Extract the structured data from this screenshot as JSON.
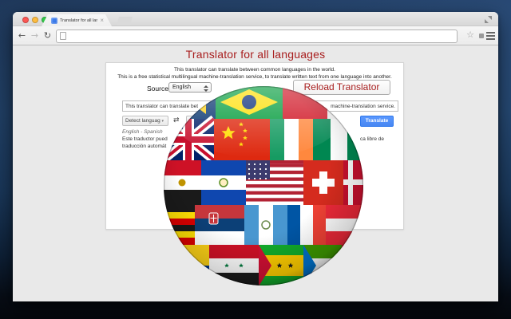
{
  "window": {
    "tab": {
      "title": "Translator for all languages",
      "close_icon": "×"
    },
    "toolbar": {
      "back_icon": "←",
      "forward_icon": "→",
      "reload_icon": "↻",
      "url_value": "",
      "bookmark_icon": "☆"
    }
  },
  "page": {
    "title": "Translator for all languages",
    "intro_line1": "This translator can translate between common languages in the world.",
    "intro_line2": "This is a free statistical multilingual machine-translation service, to translate written text from one language into another.",
    "source_label": "Source:",
    "source_language": "English",
    "reload_button": "Reload Translator",
    "widget": {
      "input_text_left": "This translator can translate bet",
      "input_text_right": "machine-translation service.",
      "detect_language_label": "Detect languag",
      "dropdown_caret": "▾",
      "swap_icon": "⇄",
      "target_language_label": "",
      "translate_button": "Translate",
      "language_pair": "English - Spanish",
      "translation_line1_left": "Este traductor pued",
      "translation_line1_right": "ca libre de",
      "translation_line2": "traducción automát"
    },
    "globe_flags": [
      "United Kingdom",
      "Brazil",
      "China",
      "United States",
      "Switzerland",
      "Ireland",
      "Nigeria",
      "Egypt",
      "El Salvador",
      "Denmark",
      "Uganda",
      "Serbia",
      "Guatemala",
      "France",
      "Austria",
      "Colombia",
      "Syria",
      "São Tomé and Príncipe",
      "Equatorial Guinea",
      "Bosnia and Herzegovina"
    ]
  },
  "colors": {
    "accent_red": "#a81d1d",
    "translate_blue": "#4d90fe",
    "desktop_blue": "#2b4d7a"
  }
}
